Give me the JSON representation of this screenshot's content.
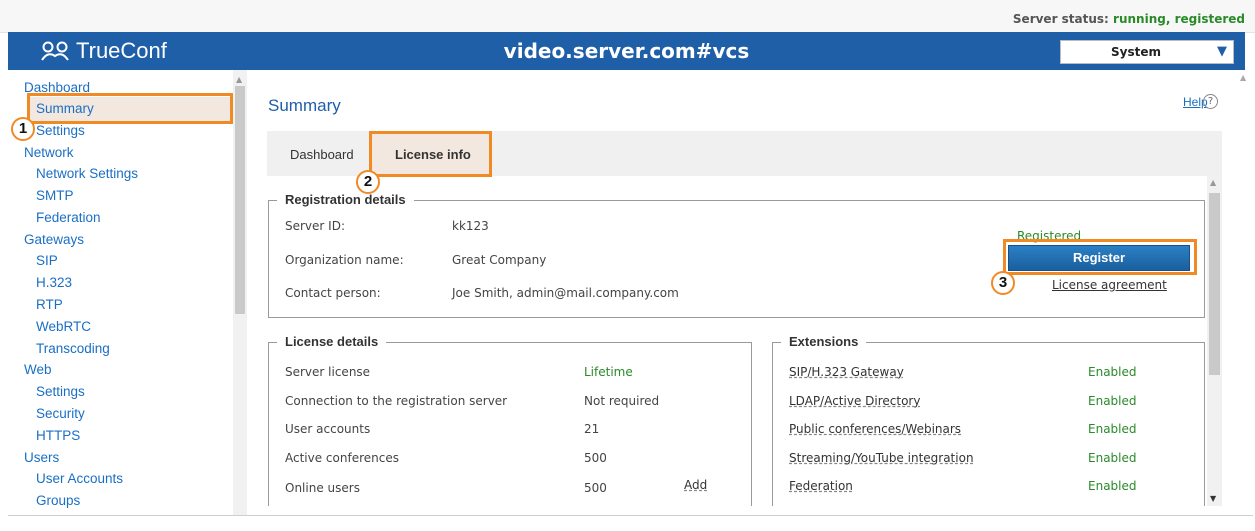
{
  "status": {
    "prefix": "Server status: ",
    "value": "running, registered"
  },
  "header": {
    "logo": "TrueConf",
    "title": "video.server.com#vcs",
    "system_select": "System"
  },
  "sidebar": {
    "items": [
      {
        "label": "Dashboard",
        "level": 1
      },
      {
        "label": "Summary",
        "level": 2
      },
      {
        "label": "Settings",
        "level": 2
      },
      {
        "label": "Network",
        "level": 1
      },
      {
        "label": "Network Settings",
        "level": 2
      },
      {
        "label": "SMTP",
        "level": 2
      },
      {
        "label": "Federation",
        "level": 2
      },
      {
        "label": "Gateways",
        "level": 1
      },
      {
        "label": "SIP",
        "level": 2
      },
      {
        "label": "H.323",
        "level": 2
      },
      {
        "label": "RTP",
        "level": 2
      },
      {
        "label": "WebRTC",
        "level": 2
      },
      {
        "label": "Transcoding",
        "level": 2
      },
      {
        "label": "Web",
        "level": 1
      },
      {
        "label": "Settings",
        "level": 2
      },
      {
        "label": "Security",
        "level": 2
      },
      {
        "label": "HTTPS",
        "level": 2
      },
      {
        "label": "Users",
        "level": 1
      },
      {
        "label": "User Accounts",
        "level": 2
      },
      {
        "label": "Groups",
        "level": 2
      }
    ]
  },
  "main": {
    "title": "Summary",
    "help": "Help",
    "help_icon": "?",
    "tabs": [
      {
        "label": "Dashboard"
      },
      {
        "label": "License info"
      }
    ]
  },
  "registration": {
    "legend": "Registration details",
    "server_id_label": "Server ID:",
    "server_id": "kk123",
    "org_label": "Organization name:",
    "org": "Great Company",
    "contact_label": "Contact person:",
    "contact": "Joe Smith, admin@mail.company.com",
    "status": "Registered",
    "register_button": "Register",
    "license_agreement": "License agreement"
  },
  "license": {
    "legend": "License details",
    "rows": [
      {
        "label": "Server license",
        "value": "Lifetime"
      },
      {
        "label": "Connection to the registration server",
        "value": "Not required"
      },
      {
        "label": "User accounts",
        "value": "21"
      },
      {
        "label": "Active conferences",
        "value": "500"
      },
      {
        "label": "Online users",
        "value": "500"
      }
    ],
    "add_link": "Add"
  },
  "extensions": {
    "legend": "Extensions",
    "rows": [
      {
        "label": "SIP/H.323 Gateway",
        "value": "Enabled"
      },
      {
        "label": "LDAP/Active Directory",
        "value": "Enabled"
      },
      {
        "label": "Public conferences/Webinars",
        "value": "Enabled"
      },
      {
        "label": "Streaming/YouTube integration",
        "value": "Enabled"
      },
      {
        "label": "Federation",
        "value": "Enabled"
      }
    ]
  },
  "annotations": [
    "1",
    "2",
    "3"
  ],
  "colors": {
    "brand": "#1f5fa8",
    "accent": "#f08a24",
    "ok": "#2a8a2a"
  }
}
